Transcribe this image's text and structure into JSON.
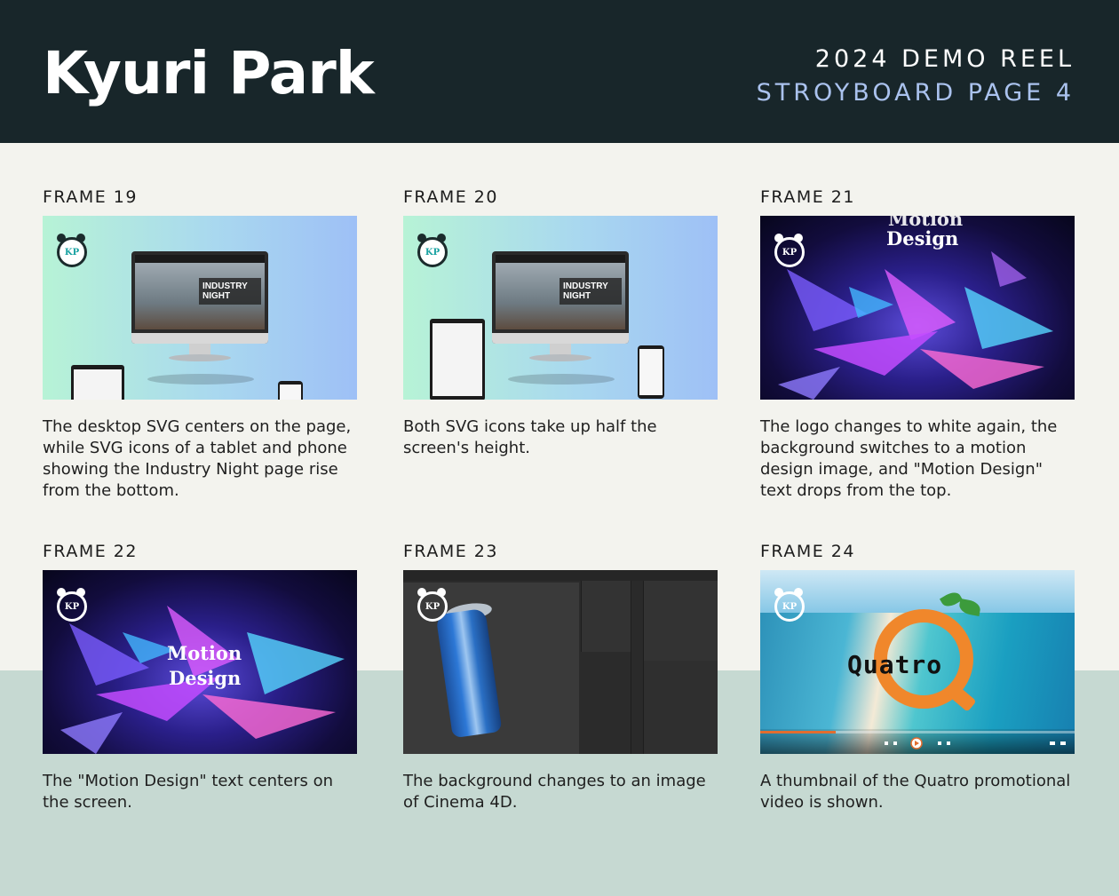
{
  "header": {
    "name": "Kyuri Park",
    "reel_title": "2024 DEMO REEL",
    "page_title": "STROYBOARD PAGE 4"
  },
  "colors": {
    "header_bg": "#18262a",
    "page_bg": "#f3f3ee",
    "bottom_band": "#c6d9d2",
    "accent_blue": "#aac2ee",
    "quatro_orange": "#f0872b"
  },
  "frames": [
    {
      "label": "FRAME 19",
      "description": "The desktop SVG centers on the page, while SVG icons of a tablet and phone showing the Industry Night page rise from the bottom.",
      "thumb": {
        "logo": "KP",
        "banner": "INDUSTRY NIGHT"
      }
    },
    {
      "label": "FRAME 20",
      "description": "Both SVG icons take up half the screen's height.",
      "thumb": {
        "logo": "KP",
        "banner": "INDUSTRY NIGHT"
      }
    },
    {
      "label": "FRAME 21",
      "description": "The logo changes to white again, the background switches to a motion design image, and \"Motion Design\" text drops from the top.",
      "thumb": {
        "logo": "KP",
        "text_top": "Motion",
        "text_bottom": "Design"
      }
    },
    {
      "label": "FRAME 22",
      "description": "The \"Motion Design\" text centers on the screen.",
      "thumb": {
        "logo": "KP",
        "text_top": "Motion",
        "text_bottom": "Design"
      }
    },
    {
      "label": "FRAME 23",
      "description": "The background changes to an image of Cinema 4D.",
      "thumb": {
        "logo": "KP"
      }
    },
    {
      "label": "FRAME 24",
      "description": "A thumbnail of the Quatro promotional video is shown.",
      "thumb": {
        "logo": "KP",
        "brand": "Quatro",
        "progress": 0.24
      }
    }
  ]
}
